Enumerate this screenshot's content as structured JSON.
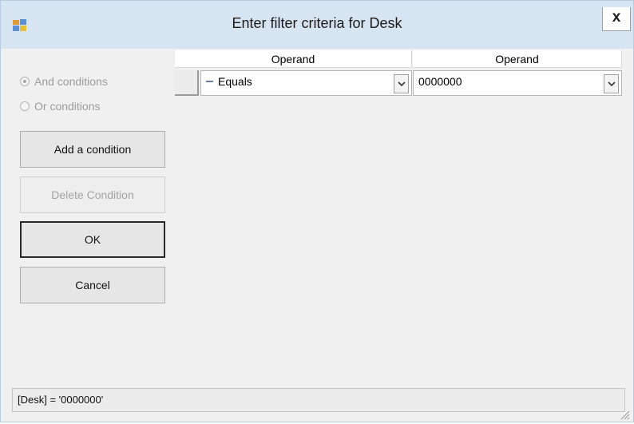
{
  "window": {
    "title": "Enter filter criteria for Desk",
    "close_label": "x"
  },
  "options": {
    "and_label": "And conditions",
    "or_label": "Or conditions",
    "selected": "and"
  },
  "buttons": {
    "add": "Add a condition",
    "delete": "Delete Condition",
    "ok": "OK",
    "cancel": "Cancel"
  },
  "grid": {
    "headers": [
      "Operand",
      "Operand"
    ],
    "rows": [
      {
        "operator": "Equals",
        "value": "0000000"
      }
    ]
  },
  "expression": "[Desk] = '0000000'"
}
